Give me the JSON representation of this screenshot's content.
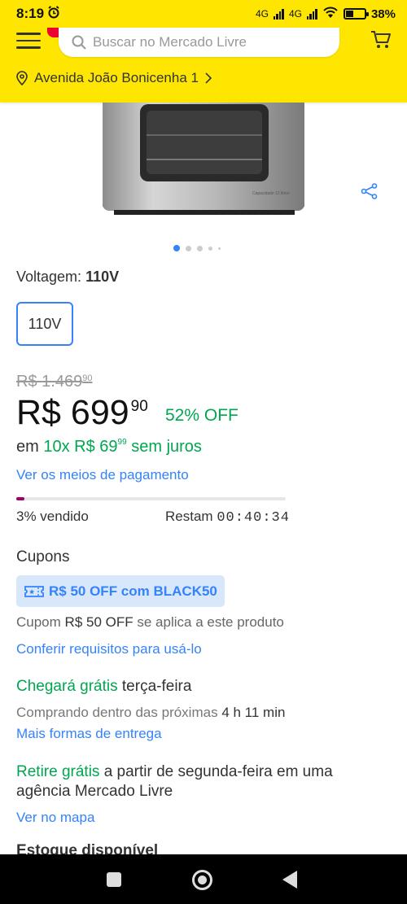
{
  "status_bar": {
    "time": "8:19",
    "network_1": "4G",
    "network_2": "4G",
    "battery_percent": "38%",
    "battery_level": 0.38
  },
  "header": {
    "search_placeholder": "Buscar no Mercado Livre",
    "address": "Avenida João Bonicenha 1",
    "brand_color": "#FFE600"
  },
  "product_image": {
    "label": "Capacidade 12 litros",
    "carousel_total": 5,
    "carousel_active": 1
  },
  "variation": {
    "label": "Voltagem: ",
    "selected": "110V",
    "option": "110V"
  },
  "pricing": {
    "old_currency": "R$",
    "old_amount": "1.469",
    "old_cents": "90",
    "currency": "R$",
    "amount": "699",
    "cents": "90",
    "discount": "52% OFF",
    "installments_prefix": "em ",
    "installments_count": "10x",
    "installment_currency": "R$",
    "installment_amount": "69",
    "installment_cents": "99",
    "installments_suffix": "sem juros",
    "payment_link": "Ver os meios de pagamento"
  },
  "stock_progress": {
    "sold_text": "3% vendido",
    "sold_fraction": 0.03,
    "remaining_label": "Restam",
    "remaining_time": "00:40:34"
  },
  "coupons": {
    "title": "Cupons",
    "chip": "R$ 50 OFF com BLACK50",
    "desc_prefix": "Cupom",
    "desc_value": "R$ 50 OFF",
    "desc_suffix": "se aplica a este produto",
    "link": "Conferir requisitos para usá-lo"
  },
  "shipping": {
    "free": "Chegará grátis",
    "day": "terça-feira",
    "sub_prefix": "Comprando dentro das próximas",
    "sub_time": "4 h 11 min",
    "link": "Mais formas de entrega"
  },
  "pickup": {
    "free": "Retire grátis",
    "text": "a partir de segunda-feira em uma agência Mercado Livre",
    "link": "Ver no mapa"
  },
  "stock": {
    "title": "Estoque disponível"
  },
  "colors": {
    "link_blue": "#3483FA",
    "green": "#00A650",
    "progress": "#A0006E"
  }
}
